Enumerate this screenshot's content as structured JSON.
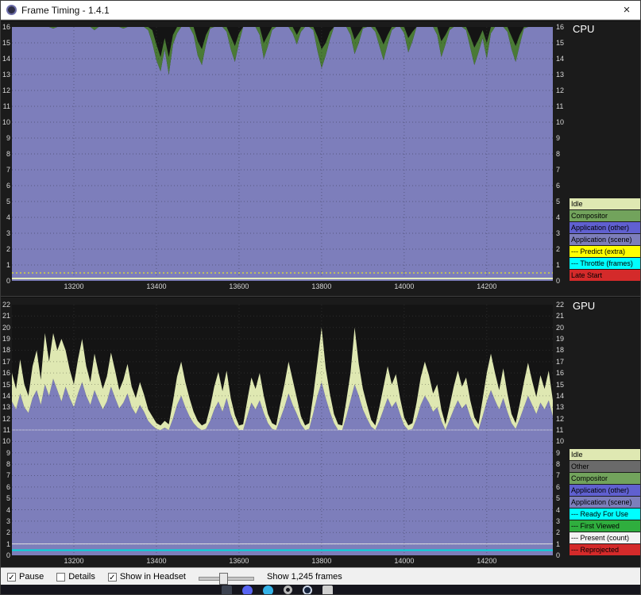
{
  "window": {
    "title": "Frame Timing - 1.4.1",
    "close_label": "×"
  },
  "controls": {
    "pause": {
      "label": "Pause",
      "checked": true
    },
    "details": {
      "label": "Details",
      "checked": false
    },
    "show_in_headset": {
      "label": "Show in Headset",
      "checked": true
    },
    "frames_label": "Show 1,245 frames"
  },
  "taskbar": {
    "icons": [
      {
        "name": "app-window-icon",
        "cls": "window-app"
      },
      {
        "name": "discord-icon",
        "cls": "discord-app"
      },
      {
        "name": "browser-icon",
        "cls": "browser-app"
      },
      {
        "name": "settings-gear-icon",
        "cls": "gear-app"
      },
      {
        "name": "steam-icon",
        "cls": "steam-app"
      },
      {
        "name": "vr-headset-icon",
        "cls": "headset-app"
      }
    ]
  },
  "chart_data": [
    {
      "id": "cpu",
      "type": "area",
      "title": "CPU",
      "ylim": [
        0,
        16
      ],
      "y_tick_step": 1,
      "x_start": 13050,
      "x_step": 10,
      "x_ticks": [
        13200,
        13400,
        13600,
        13800,
        14000,
        14200
      ],
      "grid": true,
      "legend_position": "right",
      "series": [
        {
          "name": "Application (scene)",
          "color": "#7d7ebb",
          "values": [
            16.3,
            16.3,
            16.3,
            16.3,
            16.3,
            16.3,
            16.3,
            16.3,
            16.3,
            16.3,
            15.9,
            16.3,
            16.3,
            16.3,
            16.3,
            16.3,
            16.3,
            16.3,
            16.3,
            16.3,
            15.8,
            16.3,
            16.3,
            16.3,
            16.3,
            16.3,
            16.3,
            15.9,
            16.3,
            16.3,
            16.3,
            16.3,
            16.3,
            15.8,
            15.0,
            13.9,
            13.2,
            14.6,
            13.0,
            14.9,
            15.6,
            16.3,
            16.3,
            16.3,
            15.5,
            14.2,
            13.6,
            14.9,
            15.9,
            16.3,
            16.3,
            16.3,
            15.7,
            14.6,
            13.8,
            15.0,
            16.0,
            16.3,
            16.3,
            16.3,
            15.5,
            14.0,
            14.8,
            15.8,
            16.3,
            16.3,
            16.3,
            16.3,
            15.6,
            14.9,
            15.7,
            16.3,
            16.3,
            15.8,
            14.5,
            13.4,
            14.2,
            15.2,
            16.0,
            16.3,
            16.3,
            16.3,
            15.5,
            14.3,
            15.0,
            15.9,
            16.3,
            16.3,
            15.7,
            14.8,
            13.9,
            14.9,
            15.8,
            16.3,
            16.3,
            15.6,
            14.4,
            15.1,
            16.0,
            16.3,
            16.3,
            16.3,
            16.3,
            15.5,
            14.1,
            14.9,
            15.8,
            16.3,
            16.3,
            16.3,
            15.8,
            14.7,
            13.6,
            14.4,
            15.3,
            14.0,
            15.6,
            16.3,
            16.3,
            16.3,
            15.7,
            14.6,
            13.8,
            14.9,
            15.9,
            16.3,
            16.3,
            16.3,
            16.3,
            16.3,
            16.3,
            16.3
          ]
        },
        {
          "name": "Compositor",
          "color": "#4a7a36",
          "values": [
            0,
            0,
            0,
            0,
            0,
            0,
            0,
            0,
            0,
            0,
            0.3,
            0,
            0,
            0,
            0,
            0,
            0,
            0,
            0,
            0,
            0.3,
            0,
            0,
            0,
            0,
            0,
            0,
            0.2,
            0,
            0,
            0,
            0,
            0,
            0.5,
            0.8,
            1.0,
            0.9,
            0.7,
            1.1,
            0.6,
            0.4,
            0,
            0,
            0,
            0.5,
            0.9,
            1.0,
            0.6,
            0.3,
            0,
            0,
            0,
            0.4,
            0.8,
            1.0,
            0.6,
            0.2,
            0,
            0,
            0,
            0.5,
            1.0,
            0.7,
            0.3,
            0,
            0,
            0,
            0,
            0.4,
            0.6,
            0.3,
            0,
            0,
            0.4,
            0.9,
            1.2,
            0.8,
            0.5,
            0.2,
            0,
            0,
            0,
            0.5,
            0.9,
            0.6,
            0.3,
            0,
            0,
            0.4,
            0.7,
            1.0,
            0.6,
            0.3,
            0,
            0,
            0.5,
            0.9,
            0.6,
            0.2,
            0,
            0,
            0,
            0,
            0.5,
            1.0,
            0.6,
            0.3,
            0,
            0,
            0,
            0.4,
            0.7,
            1.1,
            0.8,
            0.5,
            1.0,
            0.4,
            0,
            0,
            0,
            0.4,
            0.8,
            1.0,
            0.6,
            0.3,
            0,
            0,
            0,
            0,
            0,
            0,
            0
          ]
        }
      ],
      "hlines": [
        {
          "y": 0.15,
          "color": "#e6edbf",
          "width": 2
        },
        {
          "y": 0.5,
          "color": "#ffff00",
          "width": 1,
          "dash": "2,3"
        }
      ],
      "legend": [
        {
          "label": "Idle",
          "bg": "#dfe8b2",
          "fg": "#000000"
        },
        {
          "label": "Compositor",
          "bg": "#72a35c",
          "fg": "#000000"
        },
        {
          "label": "Application (other)",
          "bg": "#6060d0",
          "fg": "#000000"
        },
        {
          "label": "Application (scene)",
          "bg": "#7d7ebb",
          "fg": "#000000"
        },
        {
          "label": "--- Predict (extra)",
          "bg": "#ffff00",
          "fg": "#000000"
        },
        {
          "label": "--- Throttle (frames)",
          "bg": "#00ffff",
          "fg": "#000000"
        },
        {
          "label": "Late Start",
          "bg": "#d42a2a",
          "fg": "#000000"
        }
      ]
    },
    {
      "id": "gpu",
      "type": "area",
      "title": "GPU",
      "ylim": [
        0,
        22
      ],
      "y_tick_step": 1,
      "x_start": 13050,
      "x_step": 10,
      "x_ticks": [
        13200,
        13400,
        13600,
        13800,
        14000,
        14200
      ],
      "grid": true,
      "legend_position": "right",
      "series": [
        {
          "name": "Application (scene)",
          "color": "#7d7ebb",
          "values": [
            13.5,
            12.8,
            14.2,
            13.0,
            12.5,
            13.8,
            14.5,
            13.2,
            15.0,
            14.0,
            15.5,
            14.5,
            13.5,
            14.8,
            13.8,
            13.0,
            14.2,
            15.2,
            14.0,
            13.2,
            14.5,
            13.6,
            12.8,
            13.5,
            14.8,
            13.8,
            12.9,
            13.4,
            14.2,
            13.0,
            12.4,
            13.2,
            12.6,
            11.8,
            11.4,
            11.1,
            11.0,
            11.2,
            11.0,
            12.0,
            13.2,
            14.0,
            13.0,
            12.2,
            11.6,
            11.2,
            11.0,
            11.1,
            11.8,
            12.8,
            13.5,
            12.6,
            13.8,
            12.4,
            11.5,
            11.0,
            11.0,
            12.2,
            13.4,
            12.8,
            13.6,
            12.5,
            11.6,
            11.1,
            11.0,
            12.0,
            13.0,
            14.2,
            13.2,
            12.4,
            11.5,
            11.0,
            11.1,
            12.5,
            14.0,
            15.2,
            13.8,
            12.6,
            11.6,
            11.0,
            11.0,
            12.2,
            13.6,
            15.0,
            14.0,
            12.8,
            12.0,
            11.3,
            11.0,
            11.8,
            12.8,
            13.8,
            13.0,
            13.5,
            12.4,
            11.4,
            11.0,
            11.1,
            12.0,
            13.2,
            14.0,
            13.4,
            12.6,
            13.0,
            11.8,
            11.0,
            11.9,
            12.8,
            13.6,
            12.9,
            13.3,
            12.2,
            11.4,
            11.0,
            12.2,
            13.5,
            14.5,
            13.6,
            12.8,
            13.8,
            12.6,
            11.6,
            11.1,
            12.0,
            13.0,
            14.0,
            13.2,
            12.4,
            13.4,
            12.8,
            13.6,
            12.2
          ]
        },
        {
          "name": "Idle",
          "color": "#dfe8b2",
          "values": [
            2.5,
            1.8,
            3.0,
            2.0,
            1.5,
            2.8,
            3.5,
            2.2,
            4.5,
            3.0,
            4.0,
            3.5,
            5.5,
            3.2,
            2.5,
            2.0,
            3.0,
            3.8,
            2.6,
            2.0,
            3.2,
            2.4,
            1.8,
            2.2,
            3.0,
            2.4,
            1.6,
            2.0,
            2.6,
            1.8,
            1.4,
            2.0,
            1.5,
            1.0,
            0.8,
            0.5,
            0.4,
            0.6,
            0.5,
            1.5,
            2.5,
            3.0,
            2.2,
            1.6,
            1.0,
            0.6,
            0.4,
            0.5,
            1.2,
            2.0,
            2.6,
            1.8,
            2.4,
            1.4,
            0.8,
            0.4,
            0.5,
            1.4,
            2.2,
            1.8,
            2.4,
            1.5,
            0.8,
            0.5,
            0.4,
            1.3,
            2.0,
            2.8,
            2.2,
            1.4,
            0.7,
            0.4,
            0.5,
            1.6,
            3.0,
            4.8,
            2.6,
            1.6,
            0.8,
            0.5,
            0.4,
            1.4,
            2.4,
            5.0,
            2.8,
            1.8,
            1.2,
            0.6,
            0.4,
            1.2,
            2.0,
            2.8,
            2.0,
            2.4,
            1.4,
            0.7,
            0.4,
            0.5,
            1.4,
            2.4,
            3.0,
            2.4,
            1.6,
            2.0,
            1.0,
            0.5,
            1.2,
            2.0,
            2.6,
            1.9,
            2.3,
            1.4,
            0.7,
            0.5,
            1.5,
            2.5,
            3.2,
            2.4,
            1.7,
            2.6,
            1.6,
            0.8,
            0.5,
            1.3,
            2.2,
            2.9,
            2.1,
            1.5,
            2.4,
            1.8,
            2.6,
            1.4
          ]
        }
      ],
      "hlines": [
        {
          "y": 11,
          "color": "rgba(255,255,255,0.45)",
          "width": 1
        },
        {
          "y": 1.0,
          "color": "#e0e0e0",
          "width": 1
        },
        {
          "y": 0.45,
          "color": "#00d8d8",
          "width": 2
        }
      ],
      "legend": [
        {
          "label": "Idle",
          "bg": "#dfe8b2",
          "fg": "#000000"
        },
        {
          "label": "Other",
          "bg": "#6a6a6a",
          "fg": "#000000"
        },
        {
          "label": "Compositor",
          "bg": "#72a35c",
          "fg": "#000000"
        },
        {
          "label": "Application (other)",
          "bg": "#6060d0",
          "fg": "#000000"
        },
        {
          "label": "Application (scene)",
          "bg": "#7d7ebb",
          "fg": "#000000"
        },
        {
          "label": "--- Ready For Use",
          "bg": "#00ffff",
          "fg": "#000000"
        },
        {
          "label": "--- First Viewed",
          "bg": "#2fae3e",
          "fg": "#000000"
        },
        {
          "label": "--- Present (count)",
          "bg": "#f2f2f2",
          "fg": "#000000"
        },
        {
          "label": "--- Reprojected",
          "bg": "#d42a2a",
          "fg": "#000000"
        }
      ]
    }
  ]
}
